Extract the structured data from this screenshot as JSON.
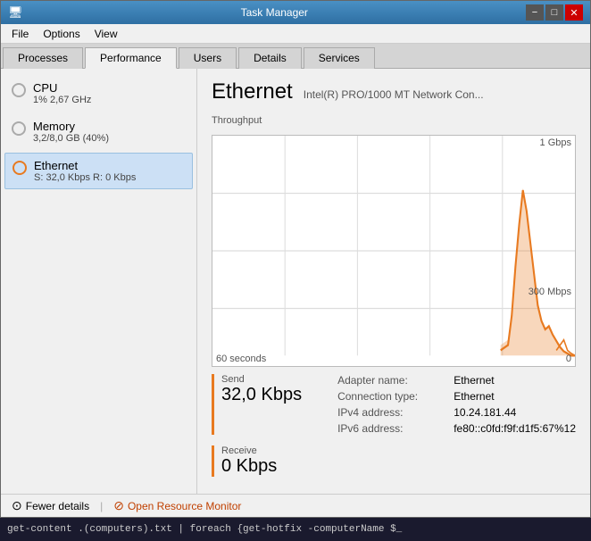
{
  "window": {
    "title": "Task Manager",
    "titlebar": {
      "minimize_label": "−",
      "maximize_label": "□",
      "close_label": "✕"
    }
  },
  "menu": {
    "items": [
      "File",
      "Options",
      "View"
    ]
  },
  "tabs": [
    {
      "label": "Processes",
      "active": false
    },
    {
      "label": "Performance",
      "active": true
    },
    {
      "label": "Users",
      "active": false
    },
    {
      "label": "Details",
      "active": false
    },
    {
      "label": "Services",
      "active": false
    }
  ],
  "sidebar": {
    "items": [
      {
        "id": "cpu",
        "label": "CPU",
        "sublabel": "1% 2,67 GHz",
        "active": false,
        "icon_color": "gray"
      },
      {
        "id": "memory",
        "label": "Memory",
        "sublabel": "3,2/8,0 GB (40%)",
        "active": false,
        "icon_color": "gray"
      },
      {
        "id": "ethernet",
        "label": "Ethernet",
        "sublabel": "S: 32,0 Kbps  R: 0 Kbps",
        "active": true,
        "icon_color": "orange"
      }
    ]
  },
  "detail": {
    "title": "Ethernet",
    "subtitle": "Intel(R) PRO/1000 MT Network Con...",
    "chart": {
      "throughput_label": "Throughput",
      "max_label": "1 Gbps",
      "mid_label": "300 Mbps",
      "time_start": "60 seconds",
      "time_end": "0"
    },
    "send": {
      "label": "Send",
      "value": "32,0 Kbps"
    },
    "receive": {
      "label": "Receive",
      "value": "0 Kbps"
    },
    "info": {
      "adapter_name_key": "Adapter name:",
      "adapter_name_val": "Ethernet",
      "connection_type_key": "Connection type:",
      "connection_type_val": "Ethernet",
      "ipv4_key": "IPv4 address:",
      "ipv4_val": "10.24.181.44",
      "ipv6_key": "IPv6 address:",
      "ipv6_val": "fe80::c0fd:f9f:d1f5:67%12"
    }
  },
  "bottom": {
    "fewer_details_label": "Fewer details",
    "open_monitor_label": "Open Resource Monitor",
    "separator": "|"
  },
  "terminal": {
    "text": "get-content .(computers).txt | foreach {get-hotfix -computerName $_"
  }
}
